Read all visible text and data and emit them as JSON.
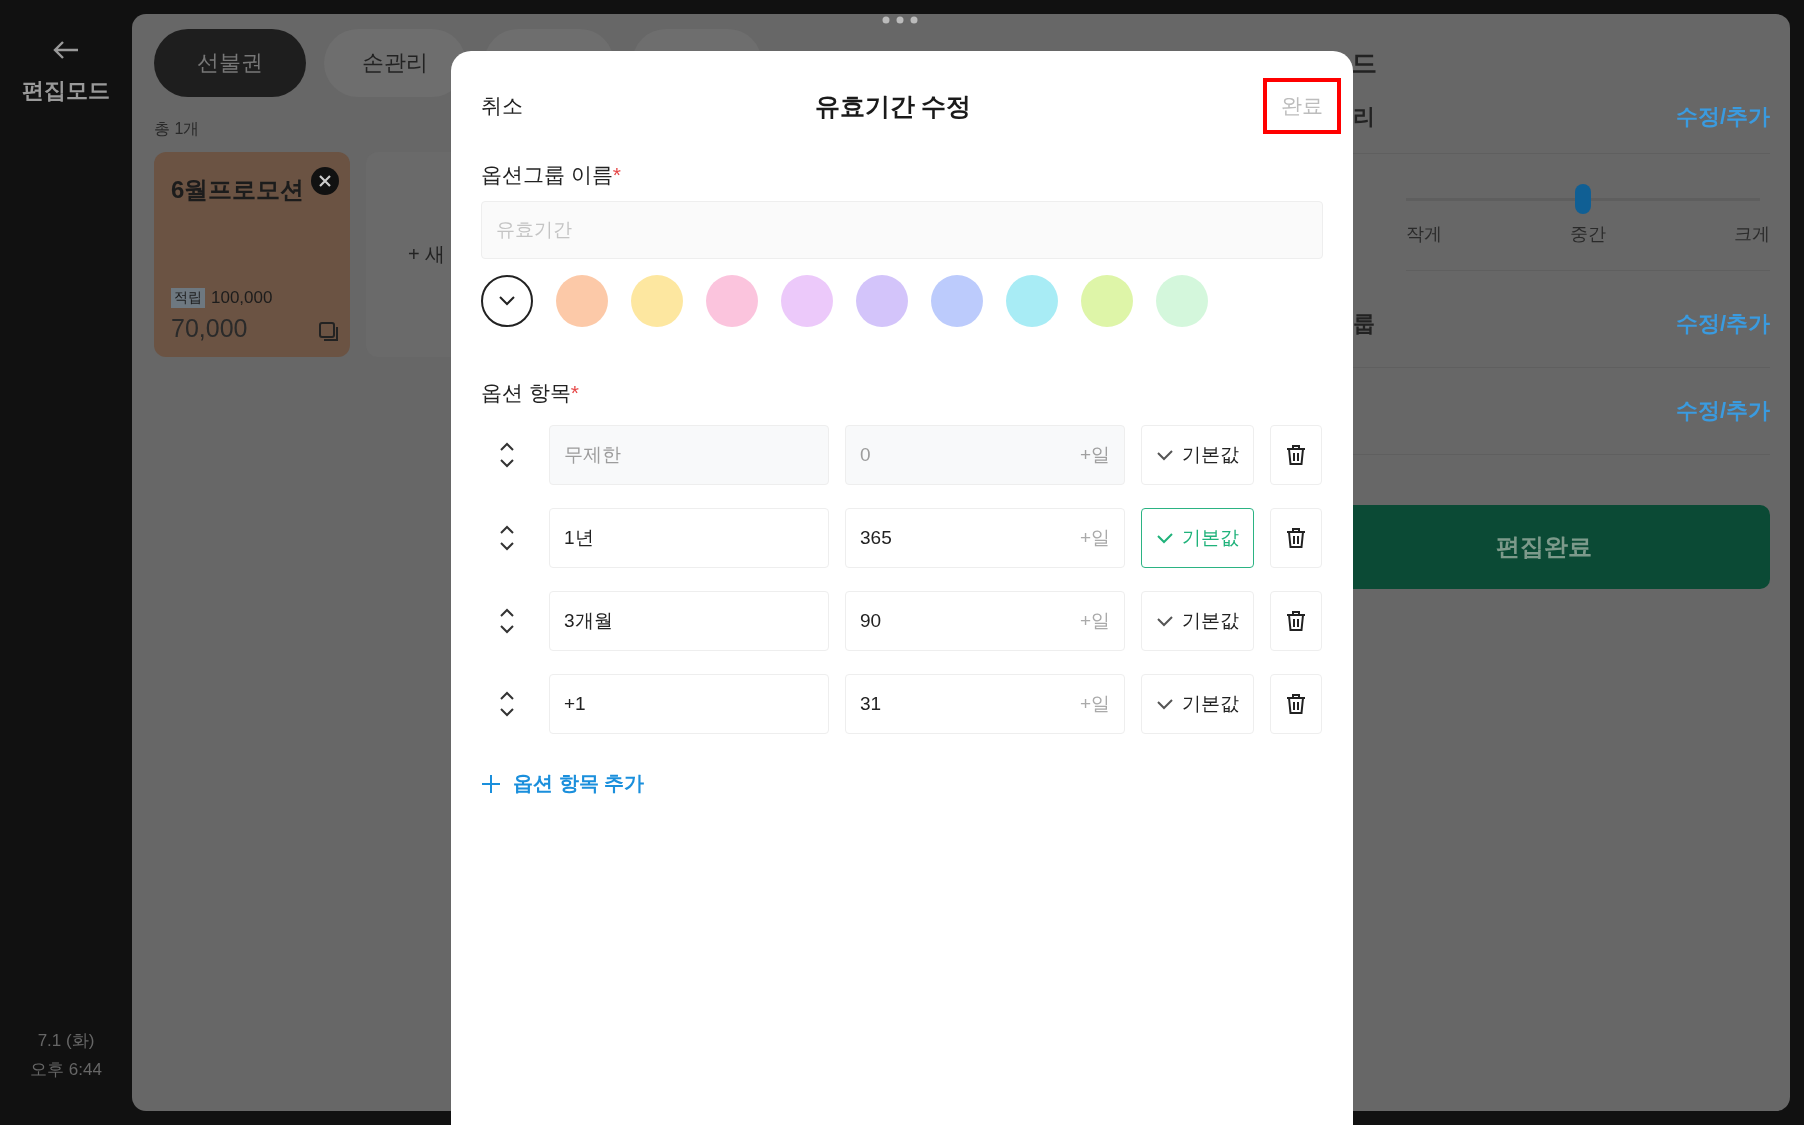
{
  "sidebar": {
    "title": "편집모드",
    "date": "7.1 (화)",
    "time": "오후 6:44"
  },
  "tabs": [
    {
      "label": "선불권",
      "selected": true
    },
    {
      "label": "손관리",
      "selected": false
    },
    {
      "selected": false
    },
    {
      "selected": false
    }
  ],
  "count": "총 1개",
  "cards": [
    {
      "title": "6월프로모션",
      "tag": "적립",
      "points": "100,000",
      "price": "70,000"
    }
  ],
  "new_card": "+ 새",
  "right_panel": {
    "title_fragment": "드",
    "sections": [
      {
        "label": "리",
        "action": "수정/추가"
      }
    ],
    "size_slider": {
      "labels": [
        "작게",
        "중간",
        "크게"
      ],
      "level": 0.5
    },
    "sections_after": [
      {
        "label": "룹",
        "action": "수정/추가"
      },
      {
        "action": "수정/추가"
      }
    ],
    "finish_button": "편집완료"
  },
  "modal": {
    "cancel": "취소",
    "title": "유효기간 수정",
    "done": "완료",
    "done_highlighted": true,
    "group_name_label": "옵션그룹 이름",
    "required_mark": "*",
    "group_name_placeholder": "유효기간",
    "colors": [
      {
        "color": "#ffffff",
        "selected": true
      },
      {
        "color": "#fcc9a8",
        "selected": false
      },
      {
        "color": "#fde7a0",
        "selected": false
      },
      {
        "color": "#fbc4dd",
        "selected": false
      },
      {
        "color": "#ecc9fa",
        "selected": false
      },
      {
        "color": "#d3c4fa",
        "selected": false
      },
      {
        "color": "#bccbfc",
        "selected": false
      },
      {
        "color": "#a8ecf5",
        "selected": false
      },
      {
        "color": "#def5a8",
        "selected": false
      },
      {
        "color": "#d4f7dc",
        "selected": false
      }
    ],
    "items_label": "옵션 항목",
    "items": [
      {
        "name": "무제한",
        "days": "0",
        "unit": "+일",
        "default_label": "기본값",
        "default": false,
        "disabled": true
      },
      {
        "name": "1년",
        "days": "365",
        "unit": "+일",
        "default_label": "기본값",
        "default": true,
        "disabled": false
      },
      {
        "name": "3개월",
        "days": "90",
        "unit": "+일",
        "default_label": "기본값",
        "default": false,
        "disabled": false
      },
      {
        "name": "+1",
        "days": "31",
        "unit": "+일",
        "default_label": "기본값",
        "default": false,
        "disabled": false
      }
    ],
    "add_item": "옵션 항목 추가"
  }
}
